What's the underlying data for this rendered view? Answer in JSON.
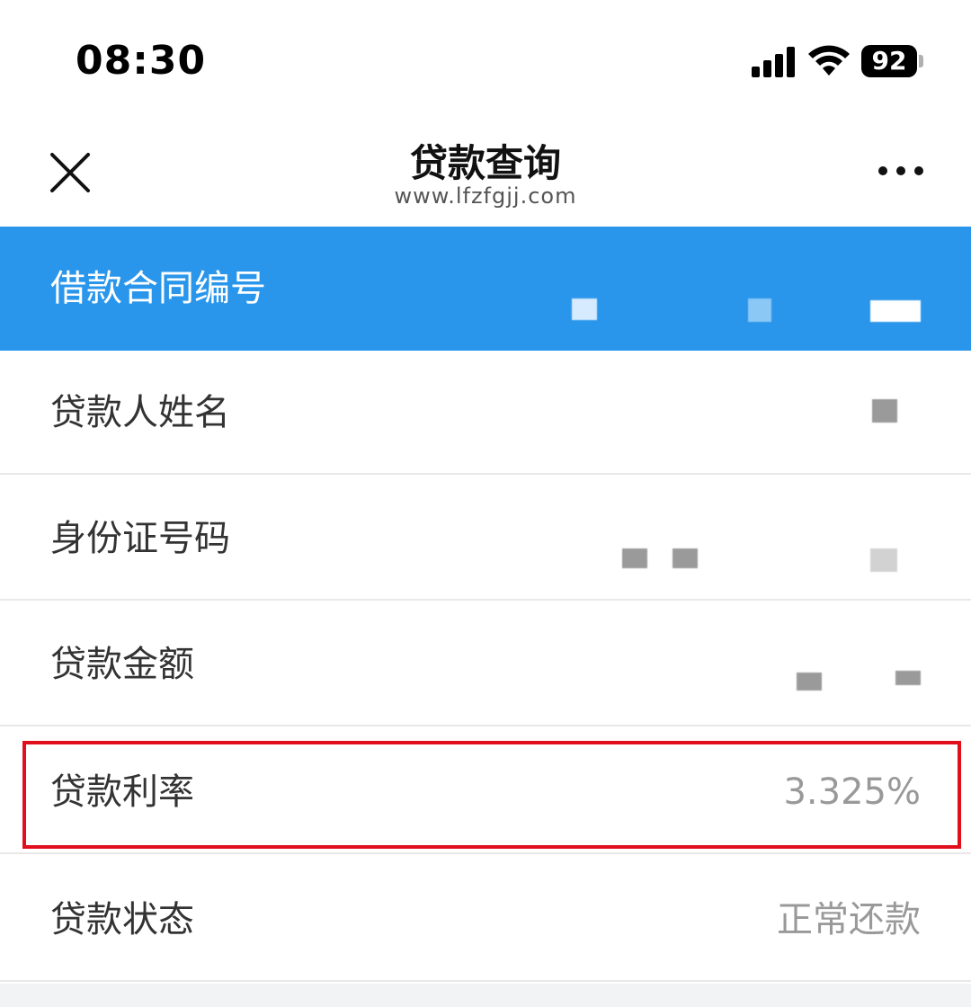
{
  "status_bar": {
    "time": "08:30",
    "battery": "92",
    "signal_icon": "cellular-signal-icon",
    "wifi_icon": "wifi-icon"
  },
  "nav": {
    "title": "贷款查询",
    "subtitle": "www.lfzfgjj.com",
    "close_icon": "close-icon",
    "more_icon": "more-icon"
  },
  "rows": [
    {
      "label": "借款合同编号",
      "value": ""
    },
    {
      "label": "贷款人姓名",
      "value": ""
    },
    {
      "label": "身份证号码",
      "value": ""
    },
    {
      "label": "贷款金额",
      "value": ""
    },
    {
      "label": "贷款利率",
      "value": "3.325%"
    },
    {
      "label": "贷款状态",
      "value": "正常还款"
    }
  ],
  "colors": {
    "header_bg": "#2a96eb",
    "highlight_border": "#e10f1c",
    "label_text": "#333333",
    "value_text": "#999999"
  }
}
